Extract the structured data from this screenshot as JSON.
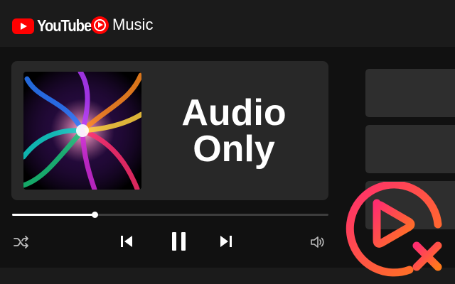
{
  "header": {
    "youtube_logo_text": "YouTube",
    "music_logo_text": "Music"
  },
  "player": {
    "title_line1": "Audio",
    "title_line2": "Only",
    "progress_fraction": 0.26
  },
  "icons": {
    "shuffle": "shuffle-icon",
    "previous": "skip-previous-icon",
    "pause": "pause-icon",
    "next": "skip-next-icon",
    "volume": "volume-icon",
    "badge": "no-video-play-icon"
  },
  "colors": {
    "brand_red": "#ff0000",
    "badge_gradient_start": "#ff2d6f",
    "badge_gradient_end": "#ff7a1a",
    "background": "#111111",
    "card": "#282828"
  }
}
